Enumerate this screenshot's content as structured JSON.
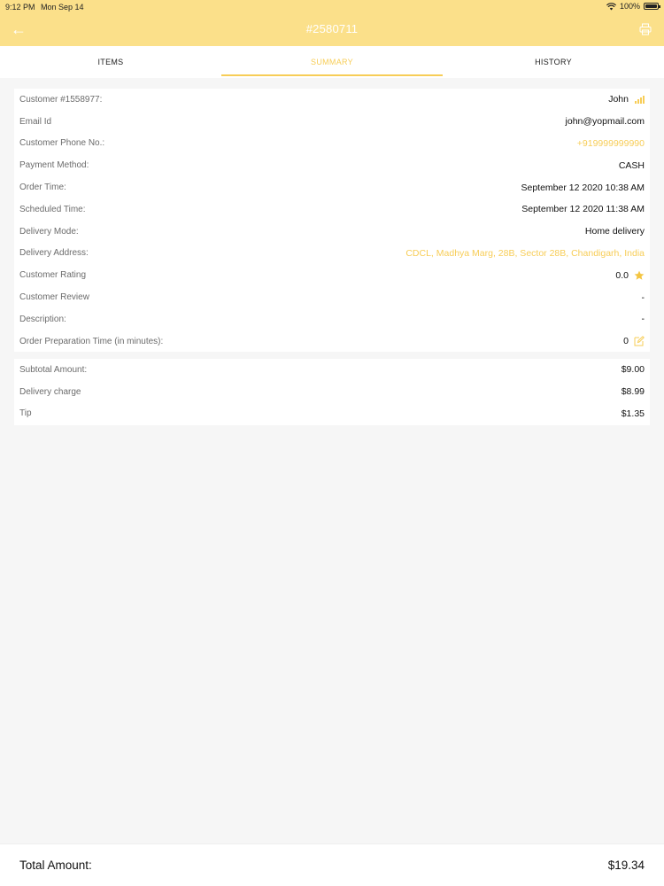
{
  "status_bar": {
    "time": "9:12 PM",
    "date": "Mon Sep 14",
    "battery": "100%"
  },
  "header": {
    "title": "#2580711"
  },
  "tabs": [
    {
      "label": "ITEMS",
      "active": false
    },
    {
      "label": "SUMMARY",
      "active": true
    },
    {
      "label": "HISTORY",
      "active": false
    }
  ],
  "details": {
    "customer": {
      "label": "Customer #1558977:",
      "value": "John"
    },
    "email": {
      "label": "Email Id",
      "value": "john@yopmail.com"
    },
    "phone": {
      "label": "Customer Phone No.:",
      "value": "+919999999990"
    },
    "payment": {
      "label": "Payment Method:",
      "value": "CASH"
    },
    "order_time": {
      "label": "Order Time:",
      "value": "September 12 2020 10:38 AM"
    },
    "scheduled_time": {
      "label": "Scheduled Time:",
      "value": "September 12 2020 11:38 AM"
    },
    "delivery_mode": {
      "label": "Delivery Mode:",
      "value": "Home delivery"
    },
    "delivery_address": {
      "label": "Delivery Address:",
      "value": "CDCL, Madhya Marg, 28B, Sector 28B, Chandigarh, India"
    },
    "rating": {
      "label": "Customer Rating",
      "value": "0.0"
    },
    "review": {
      "label": "Customer Review",
      "value": "-"
    },
    "description": {
      "label": "Description:",
      "value": "-"
    },
    "prep_time": {
      "label": "Order Preparation Time (in minutes):",
      "value": "0"
    }
  },
  "amounts": {
    "subtotal": {
      "label": "Subtotal Amount:",
      "value": "$9.00"
    },
    "delivery": {
      "label": "Delivery charge",
      "value": "$8.99"
    },
    "tip": {
      "label": "Tip",
      "value": "$1.35"
    }
  },
  "total": {
    "label": "Total Amount:",
    "value": "$19.34"
  },
  "colors": {
    "accent": "#fbe08a",
    "highlight": "#f7cd57"
  }
}
